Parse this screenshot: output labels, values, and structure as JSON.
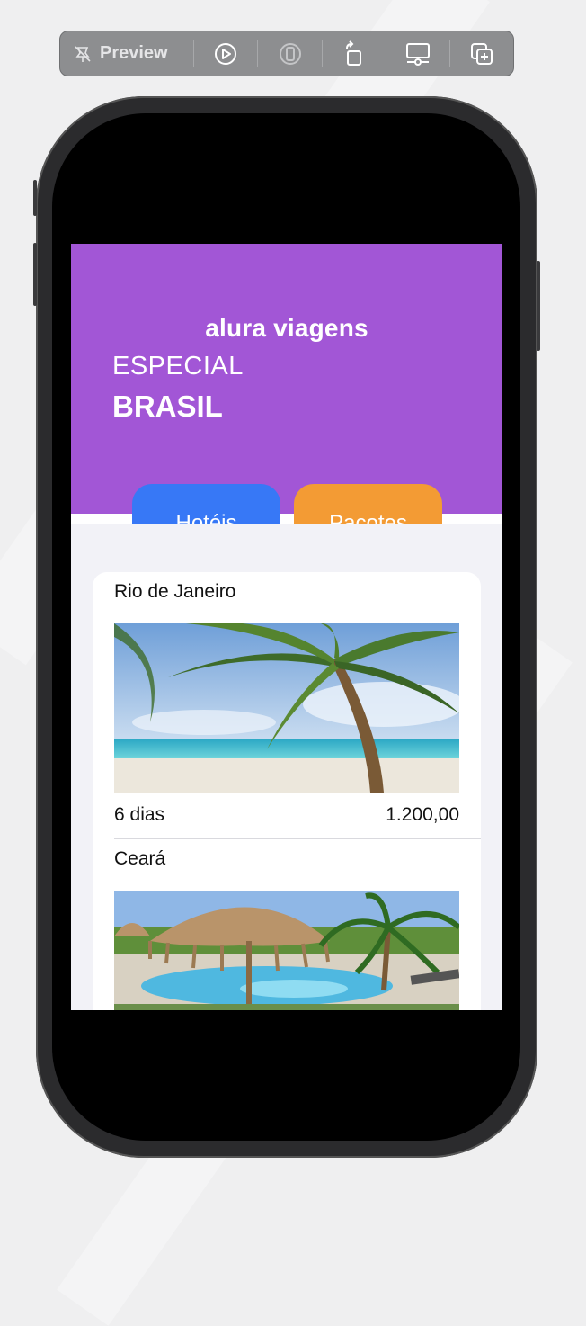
{
  "toolbar": {
    "preview_label": "Preview",
    "icons": [
      "preview-pin-icon",
      "live-play-icon",
      "device-icon",
      "rotate-icon",
      "device-settings-icon",
      "duplicate-icon"
    ]
  },
  "app": {
    "title": "alura viagens",
    "subtitle": "ESPECIAL",
    "headline": "BRASIL",
    "colors": {
      "header": "#a256d6",
      "hotels": "#3778f6",
      "packages": "#f39b34"
    }
  },
  "tabs": [
    {
      "label": "Hotéis"
    },
    {
      "label": "Pacotes"
    }
  ],
  "destinations": [
    {
      "name": "Rio de Janeiro",
      "duration": "6 dias",
      "price": "1.200,00",
      "image": "beach-palm-photo"
    },
    {
      "name": "Ceará",
      "image": "pool-resort-photo"
    }
  ]
}
